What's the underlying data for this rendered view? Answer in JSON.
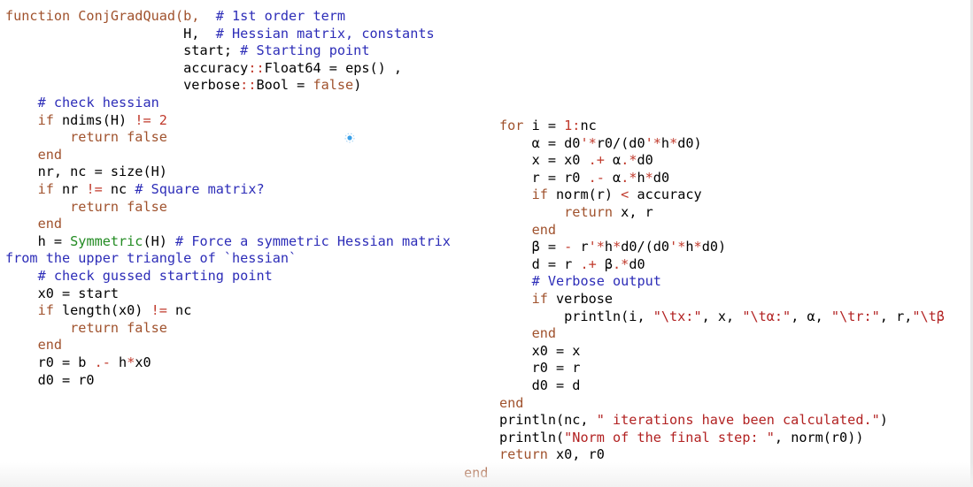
{
  "editor": {
    "left_lines": [
      [
        [
          "function ConjGradQuad(b,  ",
          "kw"
        ],
        [
          "# 1st order term",
          "cm"
        ]
      ],
      [
        [
          "                      H,  ",
          ""
        ],
        [
          "# Hessian matrix, constants",
          "cm"
        ]
      ],
      [
        [
          "                      start; ",
          ""
        ],
        [
          "# Starting point",
          "cm"
        ]
      ],
      [
        [
          "                      accuracy",
          ""
        ],
        [
          "::",
          "op"
        ],
        [
          "Float64 ",
          ""
        ],
        [
          "=",
          ""
        ],
        [
          " eps() ,",
          ""
        ]
      ],
      [
        [
          "                      verbose",
          ""
        ],
        [
          "::",
          "op"
        ],
        [
          "Bool = ",
          ""
        ],
        [
          "false",
          "kw"
        ],
        [
          ")",
          ""
        ]
      ],
      [
        [
          "    ",
          ""
        ],
        [
          "# check hessian",
          "cm"
        ]
      ],
      [
        [
          "    ",
          ""
        ],
        [
          "if",
          "kw"
        ],
        [
          " ndims(H) ",
          ""
        ],
        [
          "!=",
          "op"
        ],
        [
          " ",
          ""
        ],
        [
          "2",
          "num"
        ]
      ],
      [
        [
          "        ",
          ""
        ],
        [
          "return false",
          "kw"
        ]
      ],
      [
        [
          "    ",
          ""
        ],
        [
          "end",
          "kw"
        ]
      ],
      [
        [
          "    nr, nc = size(H)",
          ""
        ]
      ],
      [
        [
          "    ",
          ""
        ],
        [
          "if",
          "kw"
        ],
        [
          " nr ",
          ""
        ],
        [
          "!=",
          "op"
        ],
        [
          " nc ",
          ""
        ],
        [
          "# Square matrix?",
          "cm"
        ]
      ],
      [
        [
          "        ",
          ""
        ],
        [
          "return false",
          "kw"
        ]
      ],
      [
        [
          "    ",
          ""
        ],
        [
          "end",
          "kw"
        ]
      ],
      [
        [
          "    h = ",
          ""
        ],
        [
          "Symmetric",
          "ty"
        ],
        [
          "(H) ",
          ""
        ],
        [
          "# Force a symmetric Hessian matrix",
          "cm"
        ]
      ],
      [
        [
          "from the upper triangle of `hessian`",
          "cm"
        ]
      ],
      [
        [
          "    ",
          ""
        ],
        [
          "# check gussed starting point",
          "cm"
        ]
      ],
      [
        [
          "    x0 = start",
          ""
        ]
      ],
      [
        [
          "    ",
          ""
        ],
        [
          "if",
          "kw"
        ],
        [
          " length(x0) ",
          ""
        ],
        [
          "!=",
          "op"
        ],
        [
          " nc",
          ""
        ]
      ],
      [
        [
          "        ",
          ""
        ],
        [
          "return false",
          "kw"
        ]
      ],
      [
        [
          "    ",
          ""
        ],
        [
          "end",
          "kw"
        ]
      ],
      [
        [
          "    r0 = b ",
          ""
        ],
        [
          ".-",
          "op"
        ],
        [
          " h",
          ""
        ],
        [
          "*",
          "op"
        ],
        [
          "x0",
          ""
        ]
      ],
      [
        [
          "    d0 = r0",
          ""
        ]
      ]
    ],
    "right_lines": [
      [
        [
          "for",
          "kw"
        ],
        [
          " i = ",
          ""
        ],
        [
          "1:",
          "num"
        ],
        [
          "nc",
          ""
        ]
      ],
      [
        [
          "    α = d0",
          ""
        ],
        [
          "'*",
          "op"
        ],
        [
          "r0/(d0",
          ""
        ],
        [
          "'*",
          "op"
        ],
        [
          "h",
          ""
        ],
        [
          "*",
          "op"
        ],
        [
          "d0)",
          ""
        ]
      ],
      [
        [
          "    x = x0 ",
          ""
        ],
        [
          ".+",
          "op"
        ],
        [
          " α",
          ""
        ],
        [
          ".*",
          "op"
        ],
        [
          "d0",
          ""
        ]
      ],
      [
        [
          "    r = r0 ",
          ""
        ],
        [
          ".-",
          "op"
        ],
        [
          " α",
          ""
        ],
        [
          ".*",
          "op"
        ],
        [
          "h",
          ""
        ],
        [
          "*",
          "op"
        ],
        [
          "d0",
          ""
        ]
      ],
      [
        [
          "    ",
          ""
        ],
        [
          "if",
          "kw"
        ],
        [
          " norm(r) ",
          ""
        ],
        [
          "<",
          "op"
        ],
        [
          " accuracy",
          ""
        ]
      ],
      [
        [
          "        ",
          ""
        ],
        [
          "return",
          "kw"
        ],
        [
          " x, r",
          ""
        ]
      ],
      [
        [
          "    ",
          ""
        ],
        [
          "end",
          "kw"
        ]
      ],
      [
        [
          "    β = ",
          ""
        ],
        [
          "-",
          "op"
        ],
        [
          " r",
          ""
        ],
        [
          "'*",
          "op"
        ],
        [
          "h",
          ""
        ],
        [
          "*",
          "op"
        ],
        [
          "d0/(d0",
          ""
        ],
        [
          "'*",
          "op"
        ],
        [
          "h",
          ""
        ],
        [
          "*",
          "op"
        ],
        [
          "d0)",
          ""
        ]
      ],
      [
        [
          "    d = r ",
          ""
        ],
        [
          ".+",
          "op"
        ],
        [
          " β",
          ""
        ],
        [
          ".*",
          "op"
        ],
        [
          "d0",
          ""
        ]
      ],
      [
        [
          "    ",
          ""
        ],
        [
          "# Verbose output",
          "cm"
        ]
      ],
      [
        [
          "    ",
          ""
        ],
        [
          "if",
          "kw"
        ],
        [
          " verbose",
          ""
        ]
      ],
      [
        [
          "        println(i, ",
          ""
        ],
        [
          "\"\\tx:\"",
          "str"
        ],
        [
          ", x, ",
          ""
        ],
        [
          "\"\\tα:\"",
          "str"
        ],
        [
          ", α, ",
          ""
        ],
        [
          "\"\\tr:\"",
          "str"
        ],
        [
          ", r,",
          ""
        ],
        [
          "\"\\tβ",
          "str"
        ]
      ],
      [
        [
          "    ",
          ""
        ],
        [
          "end",
          "kw"
        ]
      ],
      [
        [
          "    x0 = x",
          ""
        ]
      ],
      [
        [
          "    r0 = r",
          ""
        ]
      ],
      [
        [
          "    d0 = d",
          ""
        ]
      ],
      [
        [
          "end",
          "kw"
        ]
      ],
      [
        [
          "println(nc, ",
          ""
        ],
        [
          "\" iterations have been calculated.\"",
          "str"
        ],
        [
          ")",
          ""
        ]
      ],
      [
        [
          "println(",
          ""
        ],
        [
          "\"Norm of the final step: \"",
          "str"
        ],
        [
          ", norm(r0))",
          ""
        ]
      ],
      [
        [
          "return",
          "kw"
        ],
        [
          " x0, r0",
          ""
        ]
      ]
    ],
    "final_end": [
      [
        "end",
        "kw"
      ]
    ]
  }
}
